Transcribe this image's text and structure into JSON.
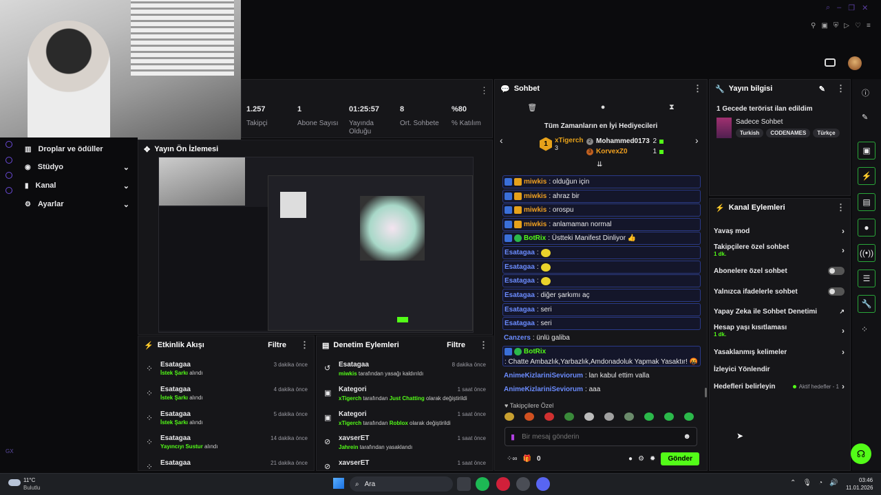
{
  "colors": {
    "accent": "#53fc18",
    "bg": "#0b0b0d",
    "panel": "#161619"
  },
  "stats": [
    {
      "value": "1.257",
      "label": "Takipçi"
    },
    {
      "value": "1",
      "label": "Abone Sayısı"
    },
    {
      "value": "01:25:57",
      "label": "Yayında Olduğu"
    },
    {
      "value": "8",
      "label": "Ort. Sohbete"
    },
    {
      "value": "%80",
      "label": "% Katılım"
    }
  ],
  "sidebar": {
    "items": [
      {
        "label": "Droplar ve ödüller"
      },
      {
        "label": "Stüdyo"
      },
      {
        "label": "Kanal"
      },
      {
        "label": "Ayarlar"
      }
    ],
    "gx": "GX"
  },
  "preview": {
    "title": "Yayın Ön İzlemesi"
  },
  "chat": {
    "title": "Sohbet",
    "top_gifters_title": "Tüm Zamanların en İyi Hediyecileri",
    "gifters": [
      {
        "rank": "1",
        "name": "xTigerch",
        "count": "3"
      },
      {
        "rank": "2",
        "name": "Mohammed0173",
        "count": "2"
      },
      {
        "rank": "3",
        "name": "KorvexZ0",
        "count": "1"
      }
    ],
    "messages": [
      {
        "user": "miwkis",
        "text": ": olduğun için"
      },
      {
        "user": "miwkis",
        "text": ": ahraz bir"
      },
      {
        "user": "miwkis",
        "text": ": orospu"
      },
      {
        "user": "miwkis",
        "text": ": anlamaman normal"
      },
      {
        "user": "BotRix",
        "text": ": Üstteki Manifest Dinliyor 👍"
      },
      {
        "user": "Esatagaa",
        "text": ":"
      },
      {
        "user": "Esatagaa",
        "text": ":"
      },
      {
        "user": "Esatagaa",
        "text": ":"
      },
      {
        "user": "Esatagaa",
        "text": ": diğer şarkımı aç"
      },
      {
        "user": "Esatagaa",
        "text": ": seri"
      },
      {
        "user": "Esatagaa",
        "text": ": seri"
      },
      {
        "user": "Canzers",
        "text": ": ünlü galiba"
      },
      {
        "user": "BotRix",
        "text": ": Chatte Ambazlık,Yarbazlık,Amdonadoluk Yapmak Yasaktır! 🤬"
      },
      {
        "user": "AnimeKizlariniSeviorum",
        "text": ": lan kabul ettim valla"
      },
      {
        "user": "AnimeKizlariniSeviorum",
        "text": ": aaa"
      }
    ],
    "followers_only": "Takipçilere Özel",
    "input_placeholder": "Bir mesaj gönderin",
    "points": "0",
    "send": "Gönder"
  },
  "info": {
    "title": "Yayın bilgisi",
    "stream_title": "1 Gecede terörist ilan edildim",
    "category": "Sadece Sohbet",
    "tags": [
      "Turkish",
      "CODENAMES",
      "Türkçe"
    ]
  },
  "actions": {
    "title": "Kanal Eylemleri",
    "items": [
      {
        "label": "Yavaş mod",
        "sub": "",
        "kind": "chevron"
      },
      {
        "label": "Takipçilere özel sohbet",
        "sub": "1 dk.",
        "kind": "chevron"
      },
      {
        "label": "Abonelere özel sohbet",
        "sub": "",
        "kind": "toggle"
      },
      {
        "label": "Yalnızca ifadelerle sohbet",
        "sub": "",
        "kind": "toggle"
      },
      {
        "label": "Yapay Zeka ile Sohbet Denetimi",
        "sub": "",
        "kind": "external"
      },
      {
        "label": "Hesap yaşı kısıtlaması",
        "sub": "1 dk.",
        "kind": "chevron"
      },
      {
        "label": "Yasaklanmış kelimeler",
        "sub": "",
        "kind": "chevron"
      },
      {
        "label": "İzleyici Yönlendir",
        "sub": "",
        "kind": "none"
      },
      {
        "label": "Hedefleri belirleyin",
        "sub": "",
        "kind": "chevron"
      }
    ],
    "goals_status": "Aktif hedefler - 1"
  },
  "activity": {
    "title": "Etkinlik Akışı",
    "filter": "Filtre",
    "items": [
      {
        "user": "Esatagaa",
        "action": "İstek Şarkı",
        "suffix": " alındı",
        "time": "3 dakika önce"
      },
      {
        "user": "Esatagaa",
        "action": "İstek Şarkı",
        "suffix": " alındı",
        "time": "4 dakika önce"
      },
      {
        "user": "Esatagaa",
        "action": "İstek Şarkı",
        "suffix": " alındı",
        "time": "5 dakika önce"
      },
      {
        "user": "Esatagaa",
        "action": "Yayıncıyı Sustur",
        "suffix": " alındı",
        "time": "14 dakika önce"
      },
      {
        "user": "Esatagaa",
        "action": "",
        "suffix": "",
        "time": "21 dakika önce"
      }
    ]
  },
  "moderation": {
    "title": "Denetim Eylemleri",
    "filter": "Filtre",
    "items": [
      {
        "title": "Esatagaa",
        "actor": "miwkis",
        "middle": " tarafından yasağı kaldırıldı",
        "target": "",
        "tail": "",
        "time": "8 dakika önce"
      },
      {
        "title": "Kategori",
        "actor": "xTigerch",
        "middle": " tarafından ",
        "target": "Just Chatting",
        "tail": " olarak değiştirildi",
        "time": "1 saat önce"
      },
      {
        "title": "Kategori",
        "actor": "xTigerch",
        "middle": " tarafından ",
        "target": "Roblox",
        "tail": " olarak değiştirildi",
        "time": "1 saat önce"
      },
      {
        "title": "xavserET",
        "actor": "Jahrein",
        "middle": " tarafından yasaklandı",
        "target": "",
        "tail": "",
        "time": "1 saat önce"
      },
      {
        "title": "xavserET",
        "actor": "",
        "middle": "",
        "target": "",
        "tail": "",
        "time": "1 saat önce"
      }
    ]
  },
  "taskbar": {
    "weather_temp": "11°C",
    "weather_desc": "Bulutlu",
    "search": "Ara",
    "time": "03:46",
    "date": "11.01.2026"
  }
}
